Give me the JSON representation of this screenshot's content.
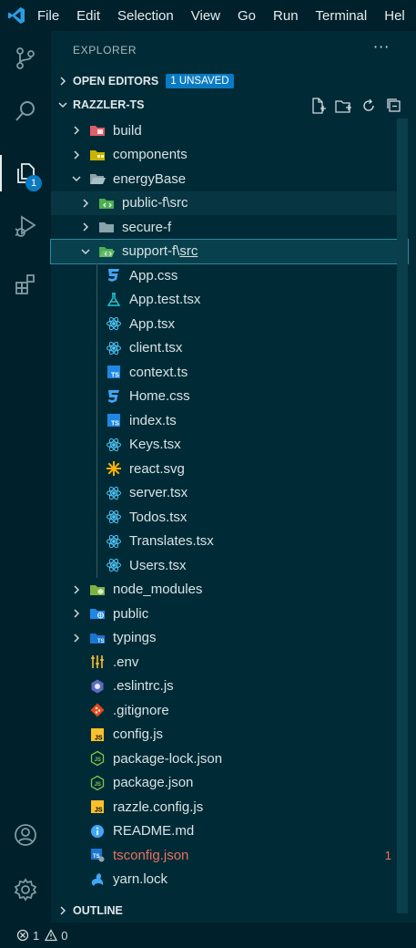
{
  "menubar": {
    "items": [
      "File",
      "Edit",
      "Selection",
      "View",
      "Go",
      "Run",
      "Terminal",
      "Hel"
    ]
  },
  "activity": {
    "explorer_badge": "1"
  },
  "sidebar": {
    "title": "EXPLORER",
    "open_editors_label": "OPEN EDITORS",
    "unsaved_badge": "1 UNSAVED",
    "project_label": "RAZZLER-TS",
    "outline_label": "OUTLINE"
  },
  "tree": [
    {
      "label": "build",
      "icon": "folder-build-icon",
      "chev": "right",
      "depth": 0
    },
    {
      "label": "components",
      "icon": "folder-components-icon",
      "chev": "right",
      "depth": 0
    },
    {
      "label": "energyBase",
      "icon": "folder-open-icon",
      "chev": "down",
      "depth": 0
    },
    {
      "label": "public-f",
      "sep": "\\",
      "src": "src",
      "icon": "folder-src-icon",
      "chev": "right",
      "depth": 1,
      "state": "sel-dim"
    },
    {
      "label": "secure-f",
      "icon": "folder-icon",
      "chev": "right",
      "depth": 1
    },
    {
      "label": "support-f",
      "sep": "\\",
      "src": "src",
      "icon": "folder-src-open-icon",
      "chev": "down",
      "depth": 1,
      "state": "sel"
    },
    {
      "label": "App.css",
      "icon": "css-icon",
      "depth": 2
    },
    {
      "label": "App.test.tsx",
      "icon": "test-flask-icon",
      "depth": 2
    },
    {
      "label": "App.tsx",
      "icon": "react-icon",
      "depth": 2
    },
    {
      "label": "client.tsx",
      "icon": "react-icon",
      "depth": 2
    },
    {
      "label": "context.ts",
      "icon": "typescript-icon",
      "depth": 2
    },
    {
      "label": "Home.css",
      "icon": "css-icon",
      "depth": 2
    },
    {
      "label": "index.ts",
      "icon": "typescript-icon",
      "depth": 2
    },
    {
      "label": "Keys.tsx",
      "icon": "react-icon",
      "depth": 2
    },
    {
      "label": "react.svg",
      "icon": "svg-sun-icon",
      "depth": 2
    },
    {
      "label": "server.tsx",
      "icon": "react-icon",
      "depth": 2
    },
    {
      "label": "Todos.tsx",
      "icon": "react-icon",
      "depth": 2
    },
    {
      "label": "Translates.tsx",
      "icon": "react-icon",
      "depth": 2
    },
    {
      "label": "Users.tsx",
      "icon": "react-icon",
      "depth": 2
    },
    {
      "label": "node_modules",
      "icon": "folder-node-icon",
      "chev": "right",
      "depth": 0
    },
    {
      "label": "public",
      "icon": "folder-public-icon",
      "chev": "right",
      "depth": 0
    },
    {
      "label": "typings",
      "icon": "folder-typings-icon",
      "chev": "right",
      "depth": 0
    },
    {
      "label": ".env",
      "icon": "env-settings-icon",
      "depth": 0
    },
    {
      "label": ".eslintrc.js",
      "icon": "eslint-icon",
      "depth": 0
    },
    {
      "label": ".gitignore",
      "icon": "git-icon",
      "depth": 0
    },
    {
      "label": "config.js",
      "icon": "javascript-icon",
      "depth": 0
    },
    {
      "label": "package-lock.json",
      "icon": "nodejs-icon",
      "depth": 0
    },
    {
      "label": "package.json",
      "icon": "nodejs-icon",
      "depth": 0
    },
    {
      "label": "razzle.config.js",
      "icon": "javascript-icon",
      "depth": 0
    },
    {
      "label": "README.md",
      "icon": "info-icon",
      "depth": 0
    },
    {
      "label": "tsconfig.json",
      "icon": "tsconfig-icon",
      "depth": 0,
      "modified": true,
      "count": "1"
    },
    {
      "label": "yarn.lock",
      "icon": "yarn-icon",
      "depth": 0
    }
  ],
  "status": {
    "errors": "1",
    "warnings": "0"
  },
  "colors": {
    "background": "#002b36",
    "chrome": "#00212b",
    "accent": "#0a7bc2",
    "modified": "#e8715f"
  }
}
